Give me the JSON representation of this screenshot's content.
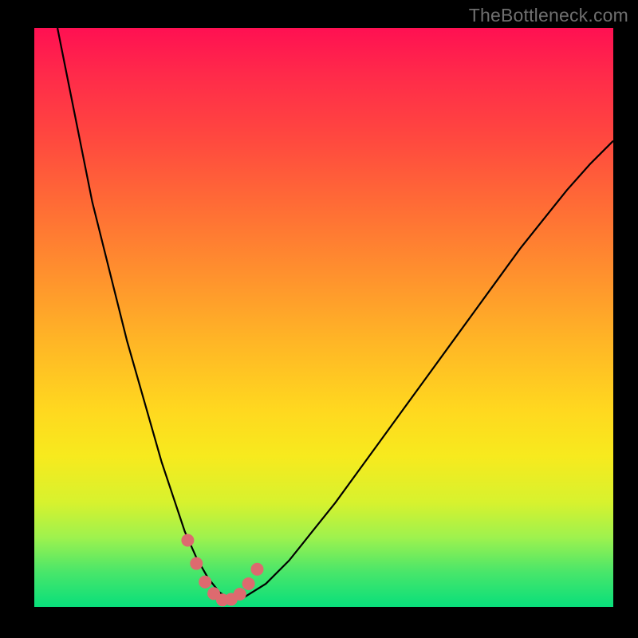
{
  "watermark": "TheBottleneck.com",
  "colors": {
    "frame": "#000000",
    "watermark_text": "#6f6f6f",
    "curve": "#000000",
    "marker_fill": "#dd6a6f",
    "marker_stroke": "#dd6a6f",
    "gradient_top": "#ff1052",
    "gradient_bottom": "#08df7b"
  },
  "chart_data": {
    "type": "line",
    "title": "",
    "xlabel": "",
    "ylabel": "",
    "x_range": [
      0,
      100
    ],
    "y_range": [
      0,
      100
    ],
    "series": [
      {
        "name": "bottleneck-curve",
        "x": [
          4,
          6,
          8,
          10,
          12,
          14,
          16,
          18,
          20,
          22,
          24,
          26,
          28,
          30,
          32,
          34,
          36,
          40,
          44,
          48,
          52,
          56,
          60,
          64,
          68,
          72,
          76,
          80,
          84,
          88,
          92,
          96,
          100
        ],
        "y": [
          100,
          90,
          80,
          70,
          62,
          54,
          46,
          39,
          32,
          25,
          19,
          13,
          8.5,
          5,
          2.5,
          1.2,
          1.5,
          4,
          8,
          13,
          18,
          23.5,
          29,
          34.5,
          40,
          45.5,
          51,
          56.5,
          62,
          67,
          72,
          76.5,
          80.5
        ]
      }
    ],
    "markers": {
      "name": "bottom-highlight",
      "x": [
        26.5,
        28,
        29.5,
        31,
        32.5,
        34,
        35.5,
        37,
        38.5
      ],
      "y": [
        11.5,
        7.5,
        4.3,
        2.3,
        1.2,
        1.3,
        2.2,
        4.0,
        6.5
      ]
    }
  }
}
